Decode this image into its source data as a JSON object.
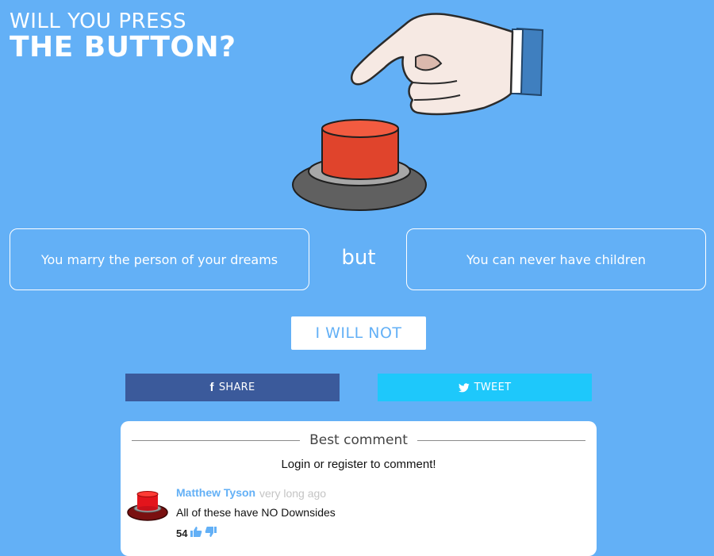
{
  "title": {
    "line1": "WILL YOU PRESS",
    "line2": "THE BUTTON?"
  },
  "options": {
    "left": "You marry the person of your dreams",
    "connector": "but",
    "right": "You can never have children"
  },
  "actions": {
    "decline_label": "I WILL NOT"
  },
  "share": {
    "facebook_label": "SHARE",
    "twitter_label": "TWEET"
  },
  "comments": {
    "heading": "Best comment",
    "login_prompt": "Login or register to comment!",
    "top": {
      "author": "Matthew Tyson",
      "time": "very long ago",
      "text": "All of these have NO Downsides",
      "likes": "54"
    }
  },
  "colors": {
    "background": "#63b0f6",
    "facebook": "#3b5a9b",
    "twitter": "#1ec8fb",
    "button_red": "#e0442c"
  }
}
